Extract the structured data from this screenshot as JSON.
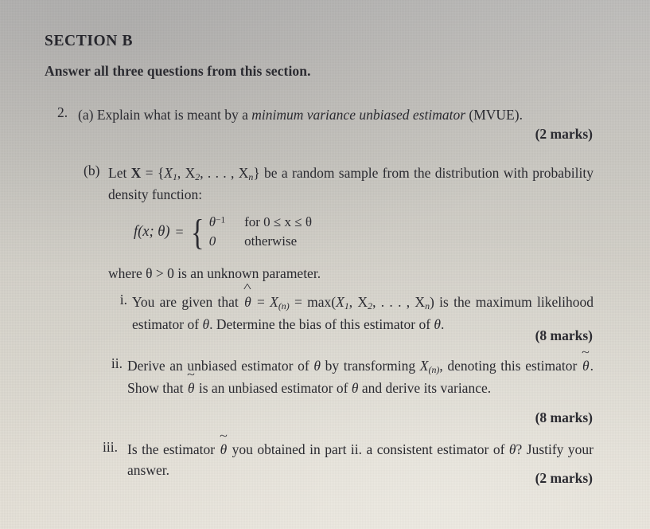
{
  "document": {
    "section_heading": "SECTION B",
    "instruction": "Answer all three questions from this section.",
    "questions": [
      {
        "number": "2.",
        "parts": [
          {
            "label": "(a)",
            "text_before_italic": "Explain what is meant by a ",
            "italic_term": "minimum variance unbiased estimator",
            "text_after_italic": " (MVUE).",
            "marks": "(2 marks)"
          },
          {
            "label": "(b)",
            "intro_line1_a": "Let ",
            "intro_bold_X": "X",
            "intro_eq": " = ",
            "intro_set": "{X",
            "intro_sub1": "1",
            "intro_comma1": ", X",
            "intro_sub2": "2",
            "intro_dots": ", . . . , X",
            "intro_subn": "n",
            "intro_close": "}",
            "intro_rest": " be a random sample from the distribution with probability density function:",
            "formula": {
              "lhs": "f(x; θ)",
              "equals": "=",
              "case1_value": "θ",
              "case1_exponent": "−1",
              "case1_condition": "for 0 ≤ x ≤ θ",
              "case2_value": "0",
              "case2_condition": "otherwise"
            },
            "where_line": "where θ > 0 is an unknown parameter.",
            "subparts": [
              {
                "label": "i.",
                "text": "You are given that θ̂ = X(n) = max(X1, X2, . . . , Xn) is the maximum likelihood estimator of θ. Determine the bias of this estimator of θ.",
                "marks": "(8 marks)"
              },
              {
                "label": "ii.",
                "text": "Derive an unbiased estimator of θ by transforming X(n), denoting this estimator θ̃. Show that θ̃ is an unbiased estimator of θ and derive its variance.",
                "marks": "(8 marks)"
              },
              {
                "label": "iii.",
                "text": "Is the estimator θ̃ you obtained in part ii. a consistent estimator of θ? Justify your answer.",
                "marks": "(2 marks)"
              }
            ]
          }
        ]
      }
    ]
  },
  "fragments": {
    "a_pre": "Explain what is meant by a ",
    "a_italic": "minimum variance unbiased estimator",
    "a_post": " (MVUE).",
    "a_label": "(a)",
    "q_number": "2.",
    "b_label": "(b)",
    "b_let": "Let ",
    "b_X": "X",
    "b_eq": " = ",
    "b_rest": " be a random sample from the distribution with probability density function:",
    "where": "where θ > 0 is an unknown parameter.",
    "f_lhs": "f(x; θ)",
    "f_eq": "=",
    "f_theta": "θ",
    "f_exp": "−1",
    "f_cond1": "for 0 ≤ x ≤ θ",
    "f_zero": "0",
    "f_cond2": "otherwise",
    "i_label": "i.",
    "i_t1": "You are given that ",
    "i_theta_hat": "θ",
    "i_t2": " = ",
    "i_t3": " = max(",
    "i_t4": ") is the maximum likelihood estimator of ",
    "i_t5": ". Determine the bias of this estimator of ",
    "i_t6": ".",
    "ii_label": "ii.",
    "ii_t1": "Derive an unbiased estimator of ",
    "ii_t2": " by transforming ",
    "ii_t3": ", denoting this estimator ",
    "ii_t4": ". Show that ",
    "ii_t5": " is an unbiased estimator of ",
    "ii_t6": " and derive its variance.",
    "iii_label": "iii.",
    "iii_t1": "Is the estimator ",
    "iii_t2": " you obtained in part ii. a consistent estimator of ",
    "iii_t3": "? Justify your answer.",
    "theta": "θ",
    "X": "X",
    "sub_n_paren": "(n)",
    "sub_1": "1",
    "sub_2": "2",
    "sub_n": "n",
    "comma_X": ", X",
    "dots_X": ", . . . , X",
    "brace_open": "{",
    "brace_close": "}",
    "marks_2a": "(2 marks)",
    "marks_i": "(8 marks)",
    "marks_ii": "(8 marks)",
    "marks_iii": "(2 marks)"
  }
}
